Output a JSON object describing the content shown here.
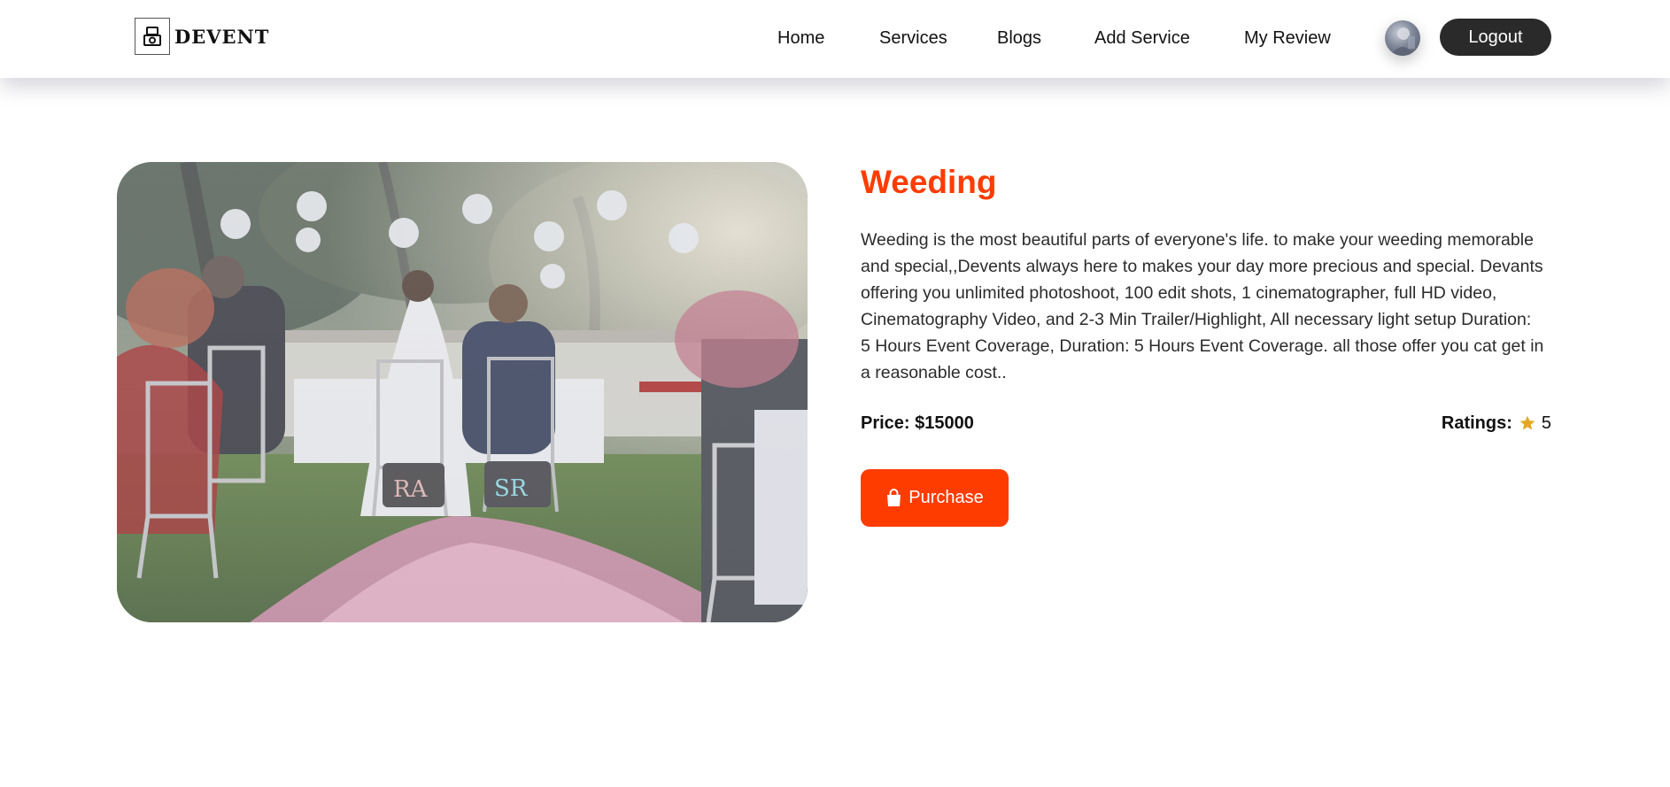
{
  "navbar": {
    "logo_text": "DEVENT",
    "links": [
      "Home",
      "Services",
      "Blogs",
      "Add Service",
      "My Review"
    ],
    "logout_label": "Logout"
  },
  "service": {
    "title": "Weeding",
    "description": "Weeding is the most beautiful parts of everyone's life. to make your weeding memorable and special,,Devents always here to makes your day more precious and special. Devants offering you unlimited photoshoot, 100 edit shots, 1 cinematographer, full HD video, Cinematography Video, and 2-3 Min Trailer/Highlight, All necessary light setup Duration: 5 Hours Event Coverage, Duration: 5 Hours Event Coverage. all those offer you cat get in a reasonable cost..",
    "price_text": "Price: $15000",
    "ratings_label": "Ratings:",
    "rating_value": "5",
    "purchase_label": "Purchase",
    "image_chalkboards": [
      "RA",
      "SR"
    ]
  },
  "colors": {
    "accent": "#ff3c00",
    "dark_button": "#2a2a2a",
    "star": "#e5a823"
  },
  "icons": {
    "logo": "camera-icon",
    "rating": "star-icon",
    "purchase": "shopping-bag-icon"
  }
}
